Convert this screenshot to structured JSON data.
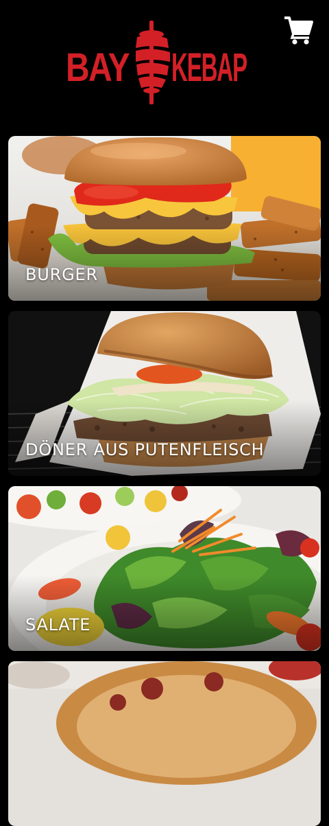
{
  "brand": {
    "left_text": "BAY",
    "right_text": "KEBAP",
    "color": "#d32027"
  },
  "header": {
    "cart_icon": "shopping-cart-icon"
  },
  "categories": [
    {
      "label": "BURGER"
    },
    {
      "label": "DÖNER AUS PUTENFLEISCH"
    },
    {
      "label": "SALATE"
    },
    {
      "label": ""
    }
  ]
}
